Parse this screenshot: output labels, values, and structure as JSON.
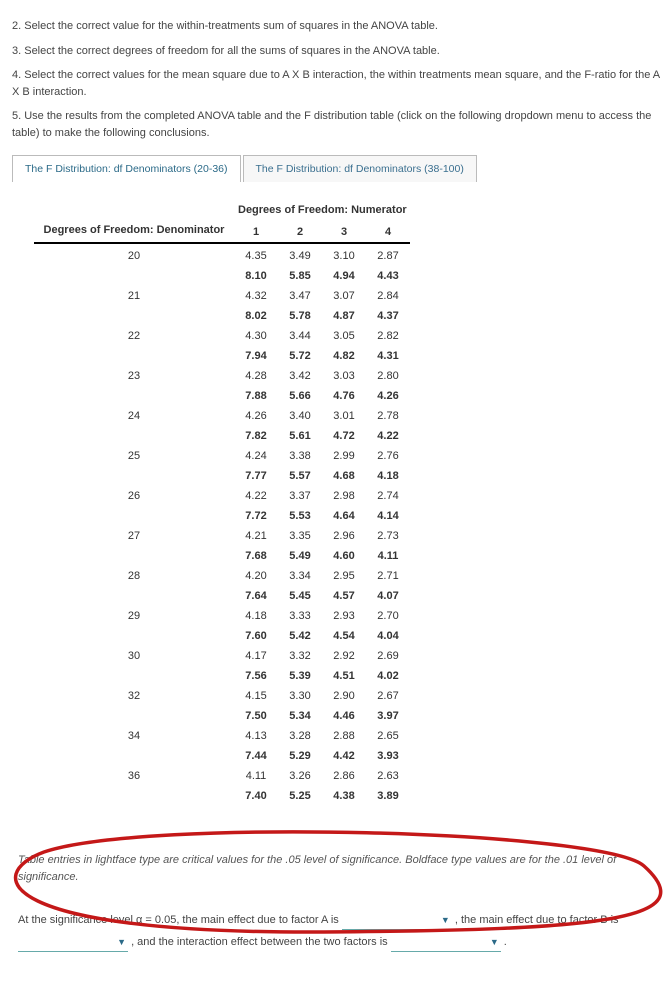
{
  "instructions": {
    "i2": "2. Select the correct value for the within-treatments sum of squares in the ANOVA table.",
    "i3": "3. Select the correct degrees of freedom for all the sums of squares in the ANOVA table.",
    "i4": "4. Select the correct values for the mean square due to A X B interaction, the within treatments mean square, and the F-ratio for the A X B interaction.",
    "i5": "5. Use the results from the completed ANOVA table and the F distribution table (click on the following dropdown menu to access the table) to make the following conclusions."
  },
  "tabs": {
    "t1": "The F Distribution: df Denominators (20-36)",
    "t2": "The F Distribution: df Denominators (38-100)"
  },
  "table": {
    "denom_header": "Degrees of Freedom: Denominator",
    "numer_header": "Degrees of Freedom: Numerator",
    "num_cols": [
      "1",
      "2",
      "3",
      "4"
    ],
    "rows": [
      {
        "d": "20",
        "a": [
          "4.35",
          "3.49",
          "3.10",
          "2.87"
        ],
        "b": [
          "8.10",
          "5.85",
          "4.94",
          "4.43"
        ]
      },
      {
        "d": "21",
        "a": [
          "4.32",
          "3.47",
          "3.07",
          "2.84"
        ],
        "b": [
          "8.02",
          "5.78",
          "4.87",
          "4.37"
        ]
      },
      {
        "d": "22",
        "a": [
          "4.30",
          "3.44",
          "3.05",
          "2.82"
        ],
        "b": [
          "7.94",
          "5.72",
          "4.82",
          "4.31"
        ]
      },
      {
        "d": "23",
        "a": [
          "4.28",
          "3.42",
          "3.03",
          "2.80"
        ],
        "b": [
          "7.88",
          "5.66",
          "4.76",
          "4.26"
        ]
      },
      {
        "d": "24",
        "a": [
          "4.26",
          "3.40",
          "3.01",
          "2.78"
        ],
        "b": [
          "7.82",
          "5.61",
          "4.72",
          "4.22"
        ]
      },
      {
        "d": "25",
        "a": [
          "4.24",
          "3.38",
          "2.99",
          "2.76"
        ],
        "b": [
          "7.77",
          "5.57",
          "4.68",
          "4.18"
        ]
      },
      {
        "d": "26",
        "a": [
          "4.22",
          "3.37",
          "2.98",
          "2.74"
        ],
        "b": [
          "7.72",
          "5.53",
          "4.64",
          "4.14"
        ]
      },
      {
        "d": "27",
        "a": [
          "4.21",
          "3.35",
          "2.96",
          "2.73"
        ],
        "b": [
          "7.68",
          "5.49",
          "4.60",
          "4.11"
        ]
      },
      {
        "d": "28",
        "a": [
          "4.20",
          "3.34",
          "2.95",
          "2.71"
        ],
        "b": [
          "7.64",
          "5.45",
          "4.57",
          "4.07"
        ]
      },
      {
        "d": "29",
        "a": [
          "4.18",
          "3.33",
          "2.93",
          "2.70"
        ],
        "b": [
          "7.60",
          "5.42",
          "4.54",
          "4.04"
        ]
      },
      {
        "d": "30",
        "a": [
          "4.17",
          "3.32",
          "2.92",
          "2.69"
        ],
        "b": [
          "7.56",
          "5.39",
          "4.51",
          "4.02"
        ]
      },
      {
        "d": "32",
        "a": [
          "4.15",
          "3.30",
          "2.90",
          "2.67"
        ],
        "b": [
          "7.50",
          "5.34",
          "4.46",
          "3.97"
        ]
      },
      {
        "d": "34",
        "a": [
          "4.13",
          "3.28",
          "2.88",
          "2.65"
        ],
        "b": [
          "7.44",
          "5.29",
          "4.42",
          "3.93"
        ]
      },
      {
        "d": "36",
        "a": [
          "4.11",
          "3.26",
          "2.86",
          "2.63"
        ],
        "b": [
          "7.40",
          "5.25",
          "4.38",
          "3.89"
        ]
      }
    ]
  },
  "footer": {
    "note": "Table entries in lightface type are critical values for the .05 level of significance. Boldface type values are for the .01 level of significance.",
    "s1a": "At the significance level α = 0.05, the main effect due to factor A is ",
    "s1b": " , the main effect due to factor B is ",
    "s1c": " , and the interaction effect between the two factors is ",
    "s1d": " ."
  }
}
